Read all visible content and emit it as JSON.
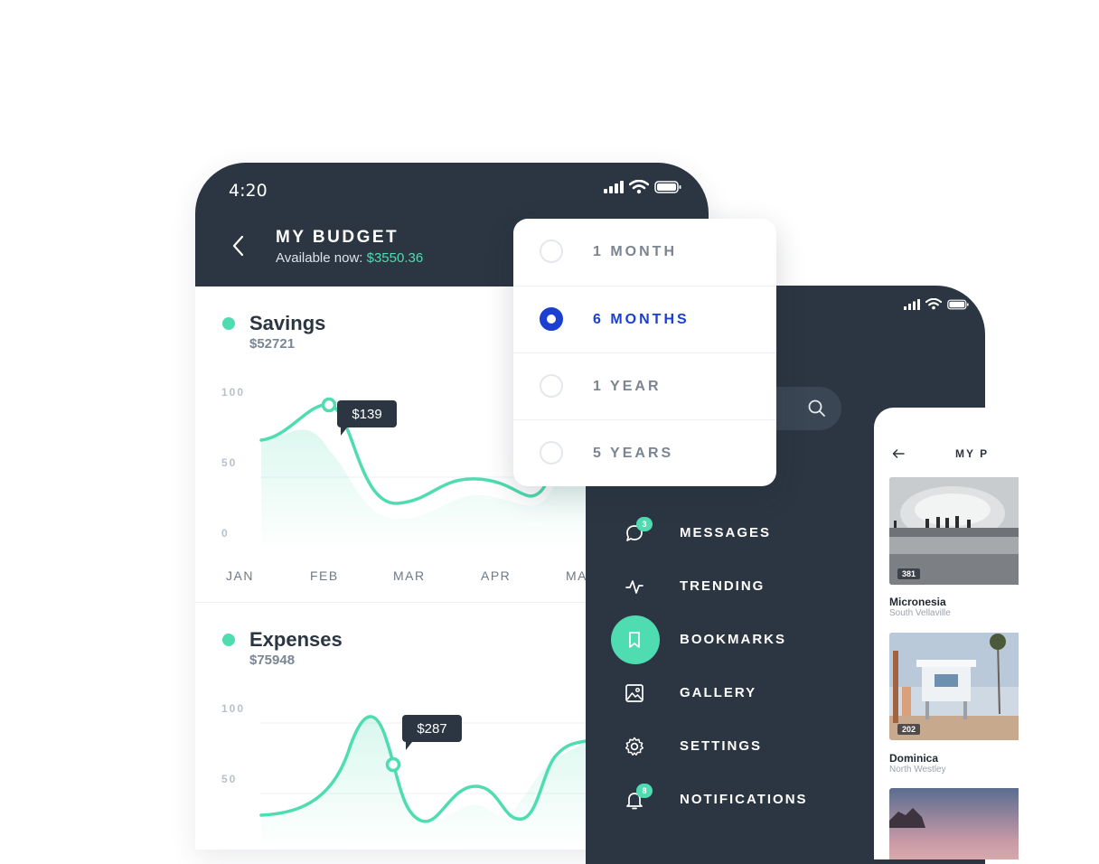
{
  "colors": {
    "dark": "#2b3642",
    "accent": "#4fdcb0",
    "selected": "#1a3fd1"
  },
  "budget_phone": {
    "time": "4:20",
    "title": "MY BUDGET",
    "available_label": "Available now:",
    "available_amount": "$3550.36",
    "icons": [
      "back-chevron-icon",
      "signal-icon",
      "wifi-icon",
      "battery-icon"
    ],
    "savings": {
      "name": "Savings",
      "value": "$52721",
      "tooltip": "$139",
      "y_ticks": [
        "100",
        "50",
        "0"
      ],
      "x_ticks": [
        "JAN",
        "FEB",
        "MAR",
        "APR",
        "MA"
      ]
    },
    "expenses": {
      "name": "Expenses",
      "value": "$75948",
      "tooltip": "$287",
      "y_ticks": [
        "100",
        "50"
      ]
    }
  },
  "period_popup": {
    "options": [
      {
        "label": "1 MONTH",
        "selected": false
      },
      {
        "label": "6 MONTHS",
        "selected": true
      },
      {
        "label": "1 YEAR",
        "selected": false
      },
      {
        "label": "5 YEARS",
        "selected": false
      }
    ]
  },
  "menu_phone": {
    "items": [
      {
        "label": "MESSAGES",
        "icon": "chat-bubble-icon",
        "badge": "3"
      },
      {
        "label": "TRENDING",
        "icon": "pulse-icon"
      },
      {
        "label": "BOOKMARKS",
        "icon": "bookmark-icon",
        "active": true
      },
      {
        "label": "GALLERY",
        "icon": "image-icon"
      },
      {
        "label": "SETTINGS",
        "icon": "gear-icon"
      },
      {
        "label": "NOTIFICATIONS",
        "icon": "bell-icon",
        "badge": "8"
      }
    ],
    "icons": [
      "search-icon",
      "signal-icon",
      "wifi-icon",
      "battery-icon"
    ]
  },
  "places_phone": {
    "title": "MY P",
    "places": [
      {
        "name": "Micronesia",
        "sub": "South Vellaville",
        "count": "381"
      },
      {
        "name": "Dominica",
        "sub": "North Westley",
        "count": "202"
      }
    ]
  }
}
